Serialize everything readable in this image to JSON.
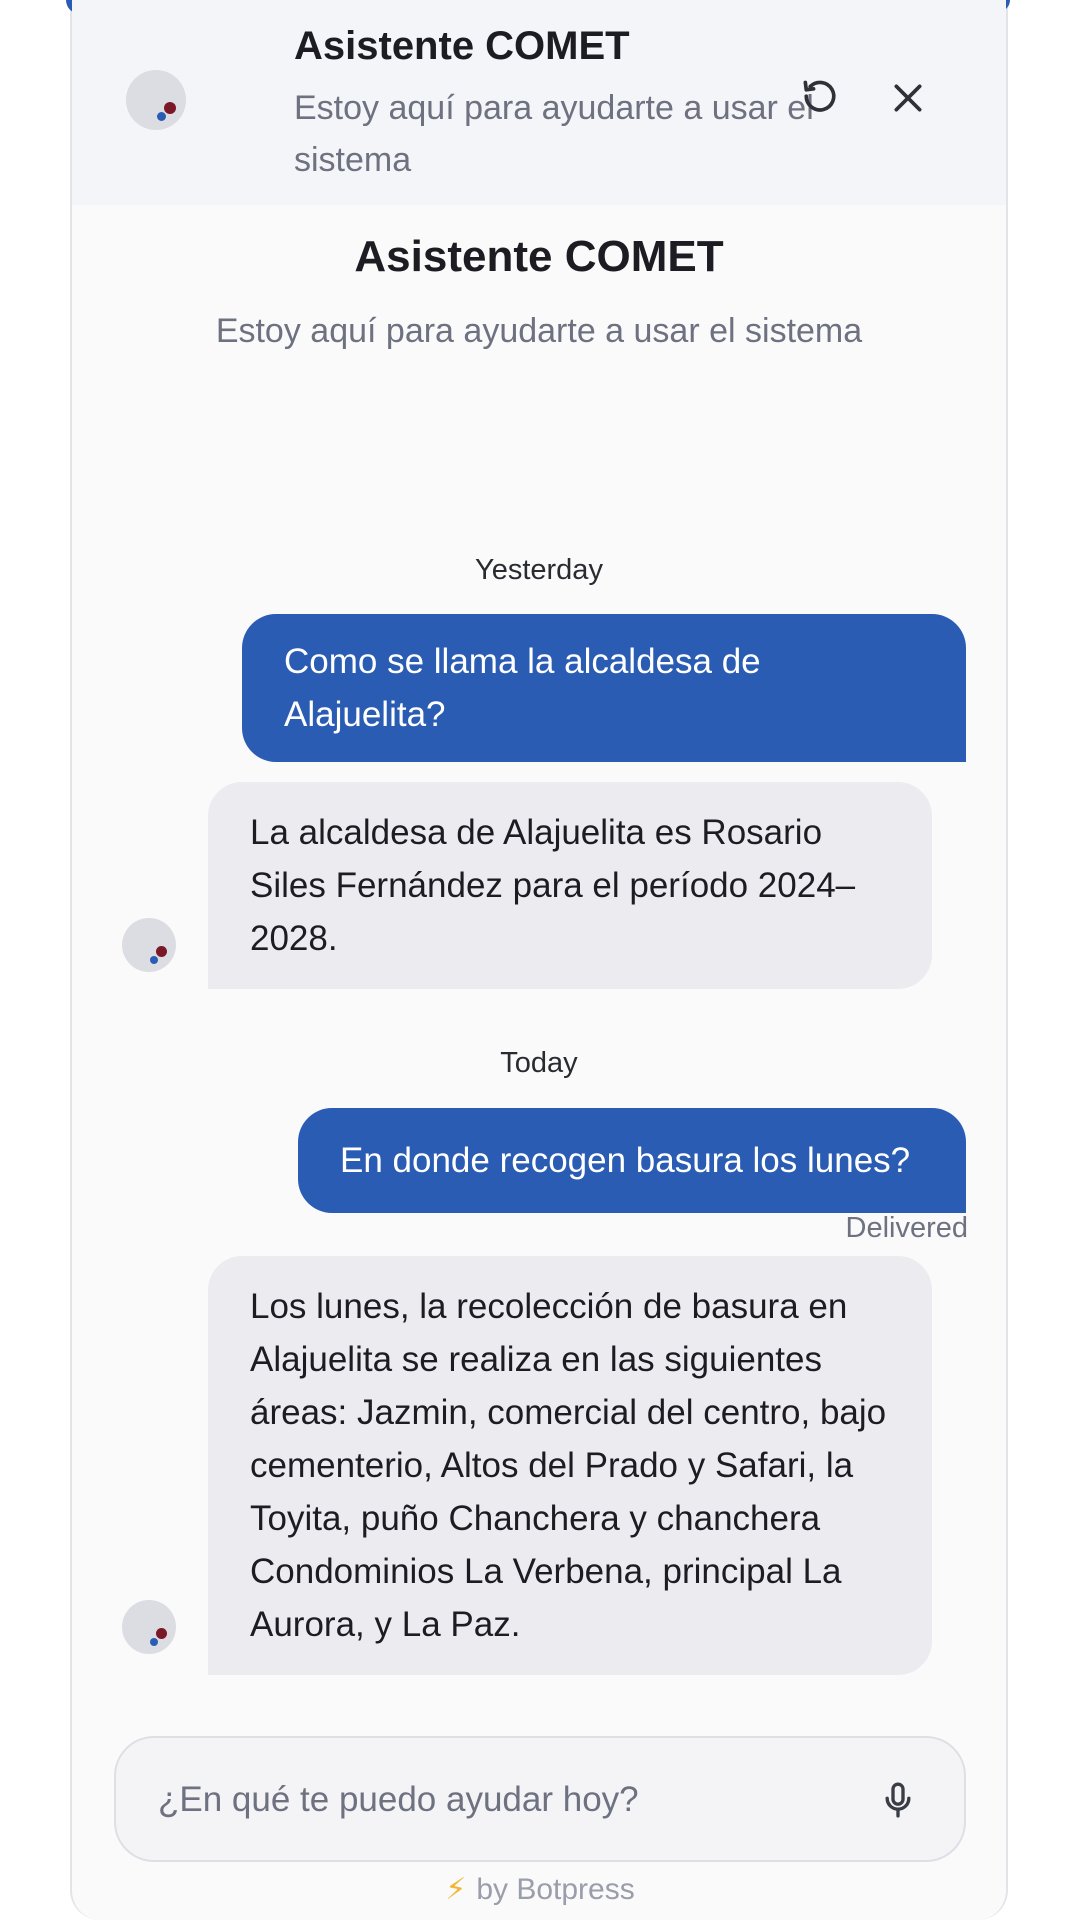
{
  "header": {
    "title": "Asistente COMET",
    "subtitle": "Estoy aquí para ayudarte a usar el sistema",
    "refresh_icon": "refresh-icon",
    "close_icon": "close-icon"
  },
  "intro": {
    "title": "Asistente COMET",
    "subtitle": "Estoy aquí para ayudarte a usar el sistema"
  },
  "conversation": {
    "day_1": "Yesterday",
    "user_message_1": "Como se llama la alcaldesa de Alajuelita?",
    "bot_message_1": "La alcaldesa de Alajuelita es Rosario Siles Fernández para el período 2024–2028.",
    "day_2": "Today",
    "user_message_2": "En donde recogen basura los lunes?",
    "status": "Delivered",
    "bot_message_2": "Los lunes, la recolección de basura en Alajuelita se realiza en las siguientes áreas: Jazmin, comercial del centro, bajo cementerio, Altos del Prado y Safari, la Toyita, puño Chanchera y chanchera Condominios La Verbena, principal La Aurora, y La Paz."
  },
  "composer": {
    "placeholder": "¿En qué te puedo ayudar hoy?",
    "mic_icon": "microphone-icon"
  },
  "footer": {
    "powered_by": "by Botpress",
    "icon": "lightning-bolt-icon"
  },
  "colors": {
    "accent": "#2a5cb4",
    "bot_bubble": "#ececf0",
    "background": "#fafafb"
  }
}
